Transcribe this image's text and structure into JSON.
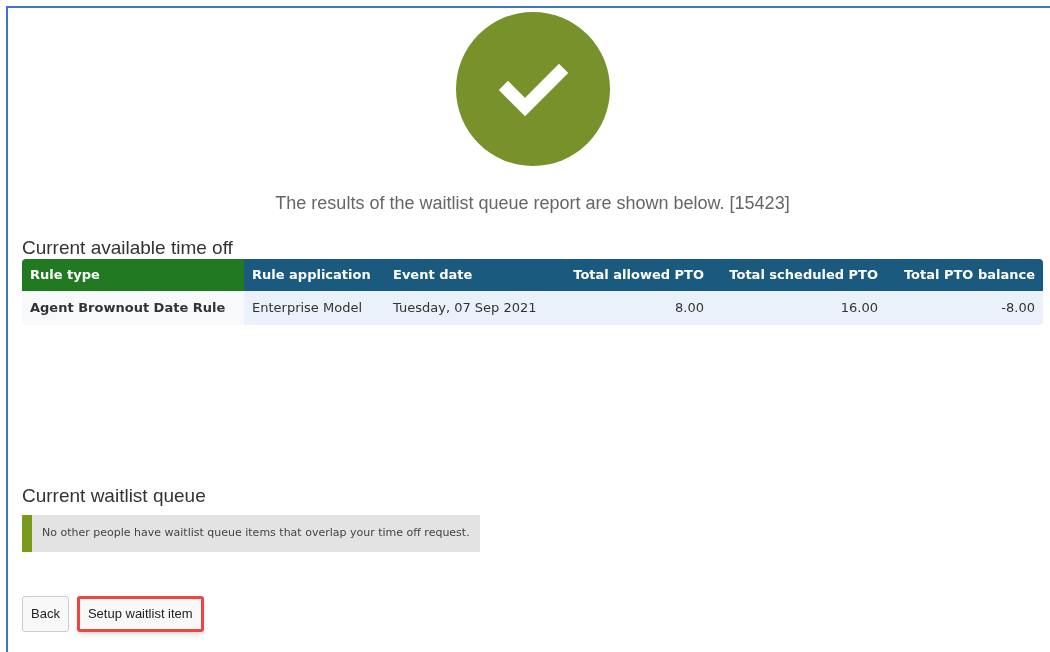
{
  "status": {
    "kind": "success"
  },
  "message": "The results of the waitlist queue report are shown below. [15423]",
  "available": {
    "heading": "Current available time off",
    "columns": [
      {
        "label": "Rule type",
        "kind": "text",
        "color": "#217a21"
      },
      {
        "label": "Rule application",
        "kind": "text",
        "color": "#1a5a7e"
      },
      {
        "label": "Event date",
        "kind": "text",
        "color": "#1a5a7e"
      },
      {
        "label": "Total allowed PTO",
        "kind": "number",
        "color": "#1a5a7e"
      },
      {
        "label": "Total scheduled PTO",
        "kind": "number",
        "color": "#1a5a7e"
      },
      {
        "label": "Total PTO balance",
        "kind": "number",
        "color": "#1a5a7e"
      }
    ],
    "rows": [
      [
        "Agent Brownout Date Rule",
        "Enterprise Model",
        "Tuesday, 07 Sep 2021",
        "8.00",
        "16.00",
        "-8.00"
      ]
    ]
  },
  "queue": {
    "heading": "Current waitlist queue",
    "notice": "No other people have waitlist queue items that overlap your time off request."
  },
  "buttons": [
    {
      "label": "Back",
      "highlighted": false
    },
    {
      "label": "Setup waitlist item",
      "highlighted": true
    }
  ]
}
